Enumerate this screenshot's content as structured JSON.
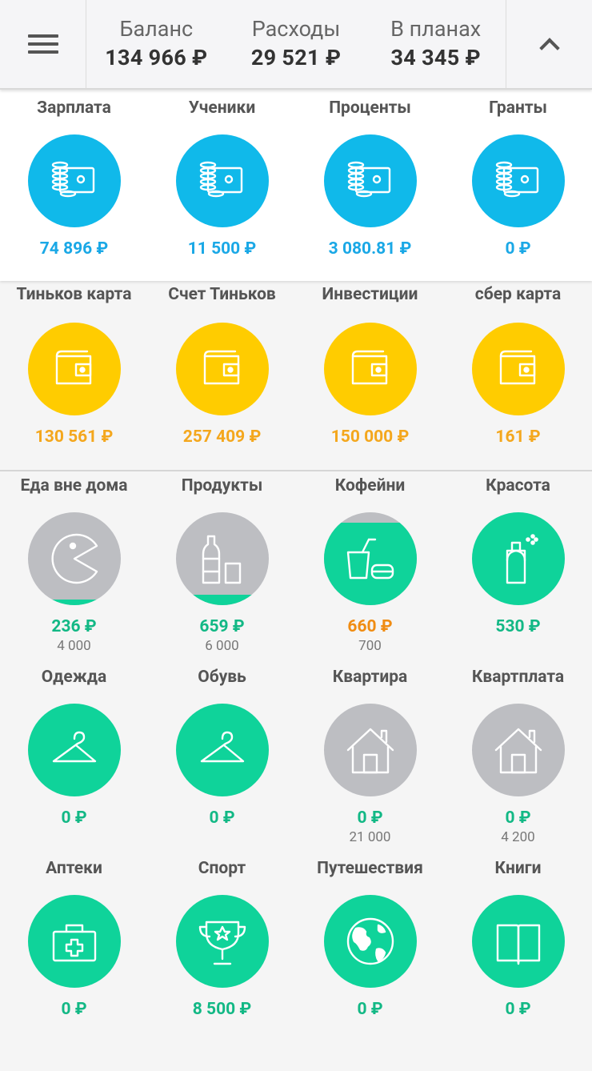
{
  "header": {
    "stats": [
      {
        "label": "Баланс",
        "value": "134 966 ₽"
      },
      {
        "label": "Расходы",
        "value": "29 521 ₽"
      },
      {
        "label": "В планах",
        "value": "34 345 ₽"
      }
    ]
  },
  "income": [
    {
      "name": "Зарплата",
      "amount": "74 896 ₽",
      "icon": "money-icon"
    },
    {
      "name": "Ученики",
      "amount": "11 500 ₽",
      "icon": "money-icon"
    },
    {
      "name": "Проценты",
      "amount": "3 080.81 ₽",
      "icon": "money-icon"
    },
    {
      "name": "Гранты",
      "amount": "0 ₽",
      "icon": "money-icon"
    }
  ],
  "accounts": [
    {
      "name": "Тиньков карта",
      "amount": "130 561 ₽",
      "icon": "wallet-icon"
    },
    {
      "name": "Счет Тиньков",
      "amount": "257 409 ₽",
      "icon": "wallet-icon"
    },
    {
      "name": "Инвестиции",
      "amount": "150 000 ₽",
      "icon": "wallet-icon"
    },
    {
      "name": "сбер карта",
      "amount": "161 ₽",
      "icon": "wallet-icon"
    }
  ],
  "expenses": [
    {
      "name": "Еда вне дома",
      "amount": "236 ₽",
      "limit": "4 000",
      "icon": "pacman-icon"
    },
    {
      "name": "Продукты",
      "amount": "659 ₽",
      "limit": "6 000",
      "icon": "bottle-glass-icon"
    },
    {
      "name": "Кофейни",
      "amount": "660 ₽",
      "limit": "700",
      "icon": "drink-burger-icon"
    },
    {
      "name": "Красота",
      "amount": "530 ₽",
      "limit": "",
      "icon": "perfume-icon"
    },
    {
      "name": "Одежда",
      "amount": "0 ₽",
      "limit": "",
      "icon": "hanger-icon"
    },
    {
      "name": "Обувь",
      "amount": "0 ₽",
      "limit": "",
      "icon": "hanger-icon"
    },
    {
      "name": "Квартира",
      "amount": "0 ₽",
      "limit": "21 000",
      "icon": "house-icon"
    },
    {
      "name": "Квартплата",
      "amount": "0 ₽",
      "limit": "4 200",
      "icon": "house-icon"
    },
    {
      "name": "Аптеки",
      "amount": "0 ₽",
      "limit": "",
      "icon": "first-aid-icon"
    },
    {
      "name": "Спорт",
      "amount": "8 500 ₽",
      "limit": "",
      "icon": "trophy-icon"
    },
    {
      "name": "Путешествия",
      "amount": "0 ₽",
      "limit": "",
      "icon": "globe-icon"
    },
    {
      "name": "Книги",
      "amount": "0 ₽",
      "limit": "",
      "icon": "book-icon"
    }
  ],
  "budget_fill": {
    "Еда вне дома": 0.059,
    "Продукты": 0.11
  },
  "colors": {
    "income": "#10b9ea",
    "account": "#ffcc00",
    "expense_ok": "#0fd39a",
    "expense_planned": "#bdbec2",
    "expense_near_limit": "#ff8a00"
  }
}
